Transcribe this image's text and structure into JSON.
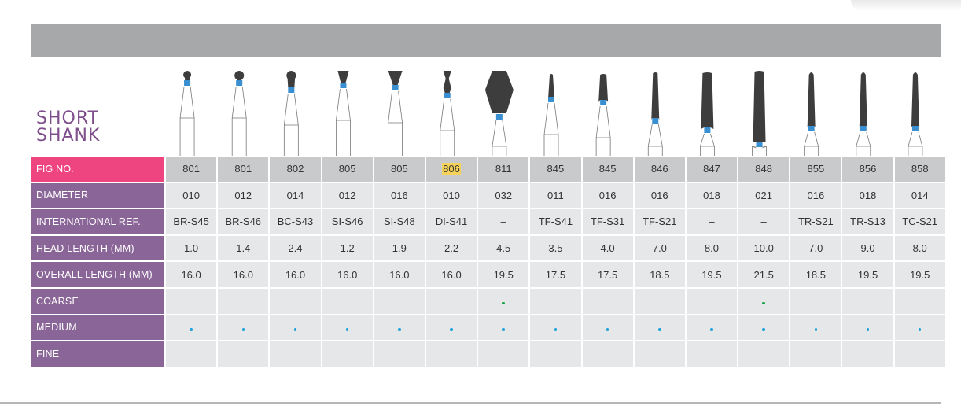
{
  "title": {
    "line1": "SHORT",
    "line2": "SHANK"
  },
  "colors": {
    "fig_label": "#ee4581",
    "row_label": "#8a6597",
    "header_band": "#a7a8aa",
    "coarse_dot": "#1aa34a",
    "medium_dot": "#1ea3dc",
    "bur_head": "#3d3d3d",
    "bur_ring": "#3a8fd0"
  },
  "rows": [
    {
      "label": "FIG NO.",
      "key": "fig",
      "values": [
        "801",
        "801",
        "802",
        "805",
        "805",
        "806",
        "811",
        "845",
        "845",
        "846",
        "847",
        "848",
        "855",
        "856",
        "858"
      ]
    },
    {
      "label": "DIAMETER",
      "key": "dia",
      "values": [
        "010",
        "012",
        "014",
        "012",
        "016",
        "010",
        "032",
        "011",
        "016",
        "016",
        "018",
        "021",
        "016",
        "018",
        "014"
      ]
    },
    {
      "label": "INTERNATIONAL REF.",
      "key": "ref",
      "values": [
        "BR-S45",
        "BR-S46",
        "BC-S43",
        "SI-S46",
        "SI-S48",
        "DI-S41",
        "–",
        "TF-S41",
        "TF-S31",
        "TF-S21",
        "–",
        "–",
        "TR-S21",
        "TR-S13",
        "TC-S21"
      ]
    },
    {
      "label": "HEAD LENGTH (MM)",
      "key": "head",
      "values": [
        "1.0",
        "1.4",
        "2.4",
        "1.2",
        "1.9",
        "2.2",
        "4.5",
        "3.5",
        "4.0",
        "7.0",
        "8.0",
        "10.0",
        "7.0",
        "9.0",
        "8.0"
      ]
    },
    {
      "label": "OVERALL LENGTH (MM)",
      "key": "overall",
      "values": [
        "16.0",
        "16.0",
        "16.0",
        "16.0",
        "16.0",
        "16.0",
        "19.5",
        "17.5",
        "17.5",
        "18.5",
        "19.5",
        "21.5",
        "18.5",
        "19.5",
        "19.5"
      ]
    },
    {
      "label": "COARSE",
      "key": "coarse",
      "dot": "coarse",
      "marks": [
        false,
        false,
        false,
        false,
        false,
        false,
        true,
        false,
        false,
        false,
        false,
        true,
        false,
        false,
        false
      ]
    },
    {
      "label": "MEDIUM",
      "key": "medium",
      "dot": "medium",
      "marks": [
        true,
        true,
        true,
        true,
        true,
        true,
        true,
        true,
        true,
        true,
        true,
        true,
        true,
        true,
        true
      ]
    },
    {
      "label": "FINE",
      "key": "fine",
      "dot": "fine",
      "marks": [
        false,
        false,
        false,
        false,
        false,
        false,
        false,
        false,
        false,
        false,
        false,
        false,
        false,
        false,
        false
      ]
    }
  ],
  "highlighted_fig_index": 5,
  "bur_shapes": [
    "round",
    "round",
    "round-neck",
    "inverted-cone",
    "inverted-cone",
    "double-inverted",
    "football",
    "taper-short",
    "taper-short",
    "taper-long",
    "taper-long",
    "taper-xlong",
    "taper-rounded",
    "taper-rounded",
    "taper-rounded"
  ]
}
